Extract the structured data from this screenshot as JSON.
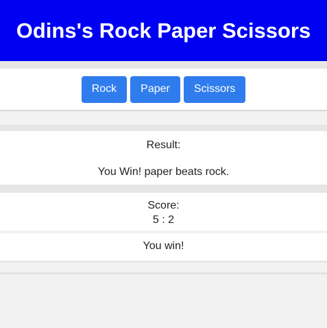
{
  "header": {
    "title": "Odins's Rock Paper Scissors",
    "background_color": "#0000f2"
  },
  "controls": {
    "buttons": [
      {
        "label": "Rock"
      },
      {
        "label": "Paper"
      },
      {
        "label": "Scissors"
      }
    ],
    "button_color": "#2f7ced"
  },
  "result": {
    "label": "Result:",
    "message": "You Win! paper beats rock."
  },
  "score": {
    "label": "Score:",
    "value": "5 : 2"
  },
  "winner": {
    "text": "You win!"
  }
}
